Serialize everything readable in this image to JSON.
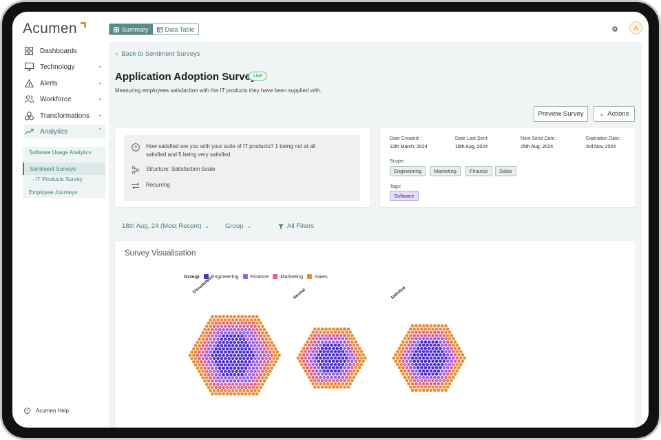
{
  "app": {
    "logo_text": "Acumen",
    "accent": "#e8922a",
    "primary": "#5a8a86"
  },
  "view_toggle": [
    {
      "label": "Summary",
      "active": true
    },
    {
      "label": "Data Table",
      "active": false
    }
  ],
  "user": {
    "initial": "A"
  },
  "sidebar": {
    "items": [
      {
        "label": "Dashboards",
        "icon": "grid-icon"
      },
      {
        "label": "Technology",
        "icon": "monitor-icon"
      },
      {
        "label": "Alerts",
        "icon": "warning-icon"
      },
      {
        "label": "Workforce",
        "icon": "people-icon"
      },
      {
        "label": "Transformations",
        "icon": "cubes-icon"
      },
      {
        "label": "Analytics",
        "icon": "trend-icon"
      }
    ],
    "sub_items": [
      "Software Usage Analytics",
      "Sentiment Surveys",
      "IT Products Survey",
      "Employee Journeys"
    ],
    "help_label": "Acumen Help"
  },
  "page": {
    "back_label": "Back to Sentiment Surveys",
    "title": "Application Adoption Survey",
    "status": "Live",
    "description": "Measuring employees satisfaction with the IT products they have been supplied with.",
    "preview_button": "Preview Survey",
    "actions_button": "Actions"
  },
  "question": {
    "text_line1": "How satisfied are you with your suite of IT products? 1 being not at all",
    "text_line2": "satisfied and 5 being very satisfied.",
    "structure": "Structure: Satisfaction Scale",
    "frequency": "Recurring"
  },
  "meta": {
    "date_created_label": "Date Created:",
    "date_created": "12th March, 2024",
    "last_sent_label": "Date Last Sent:",
    "last_sent": "18th Aug, 2024",
    "next_send_label": "Next Send Date:",
    "next_send": "25th Aug, 2024",
    "expiration_label": "Expiration Date:",
    "expiration": "3rd Nov, 2024",
    "scope_label": "Scope:",
    "scope": [
      "Engineering",
      "Marketing",
      "Finance",
      "Sales"
    ],
    "tags_label": "Tags:",
    "tags": [
      "Software"
    ]
  },
  "filters": {
    "date": "18th Aug, 24 (Most Recent)",
    "group": "Group",
    "all": "All Filters"
  },
  "visualisation": {
    "title": "Survey Visualisation",
    "legend_title": "Group",
    "groups": [
      {
        "name": "Engineering",
        "color": "#4b2fd9"
      },
      {
        "name": "Finance",
        "color": "#9b5ef0"
      },
      {
        "name": "Marketing",
        "color": "#e8628a"
      },
      {
        "name": "Sales",
        "color": "#f08a30"
      }
    ],
    "clusters": [
      {
        "label": "Dissatisfied"
      },
      {
        "label": "Neutral"
      },
      {
        "label": "Satisfied"
      }
    ]
  }
}
